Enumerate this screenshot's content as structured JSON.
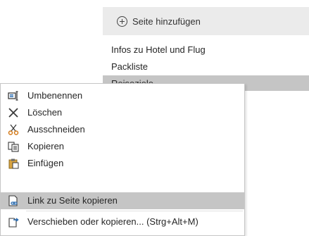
{
  "pages_panel": {
    "add_page_label": "Seite hinzufügen",
    "items": [
      {
        "label": "Infos zu Hotel und Flug"
      },
      {
        "label": "Packliste"
      },
      {
        "label": "Reiseziele"
      }
    ]
  },
  "context_menu": {
    "items": [
      {
        "label": "Umbenennen",
        "icon": "rename-icon"
      },
      {
        "label": "Löschen",
        "icon": "delete-x-icon"
      },
      {
        "label": "Ausschneiden",
        "icon": "scissors-icon"
      },
      {
        "label": "Kopieren",
        "icon": "copy-icon"
      },
      {
        "label": "Einfügen",
        "icon": "paste-icon"
      },
      {
        "label": "Link zu Seite kopieren",
        "icon": "link-page-icon"
      },
      {
        "label": "Verschieben oder kopieren... (Strg+Alt+M)",
        "icon": "move-page-icon"
      }
    ]
  },
  "colors": {
    "menu_highlight": "#c5c5c5",
    "add_page_background": "#ebebeb",
    "icon_blue": "#2b6cb0",
    "icon_orange": "#d47b1a"
  }
}
